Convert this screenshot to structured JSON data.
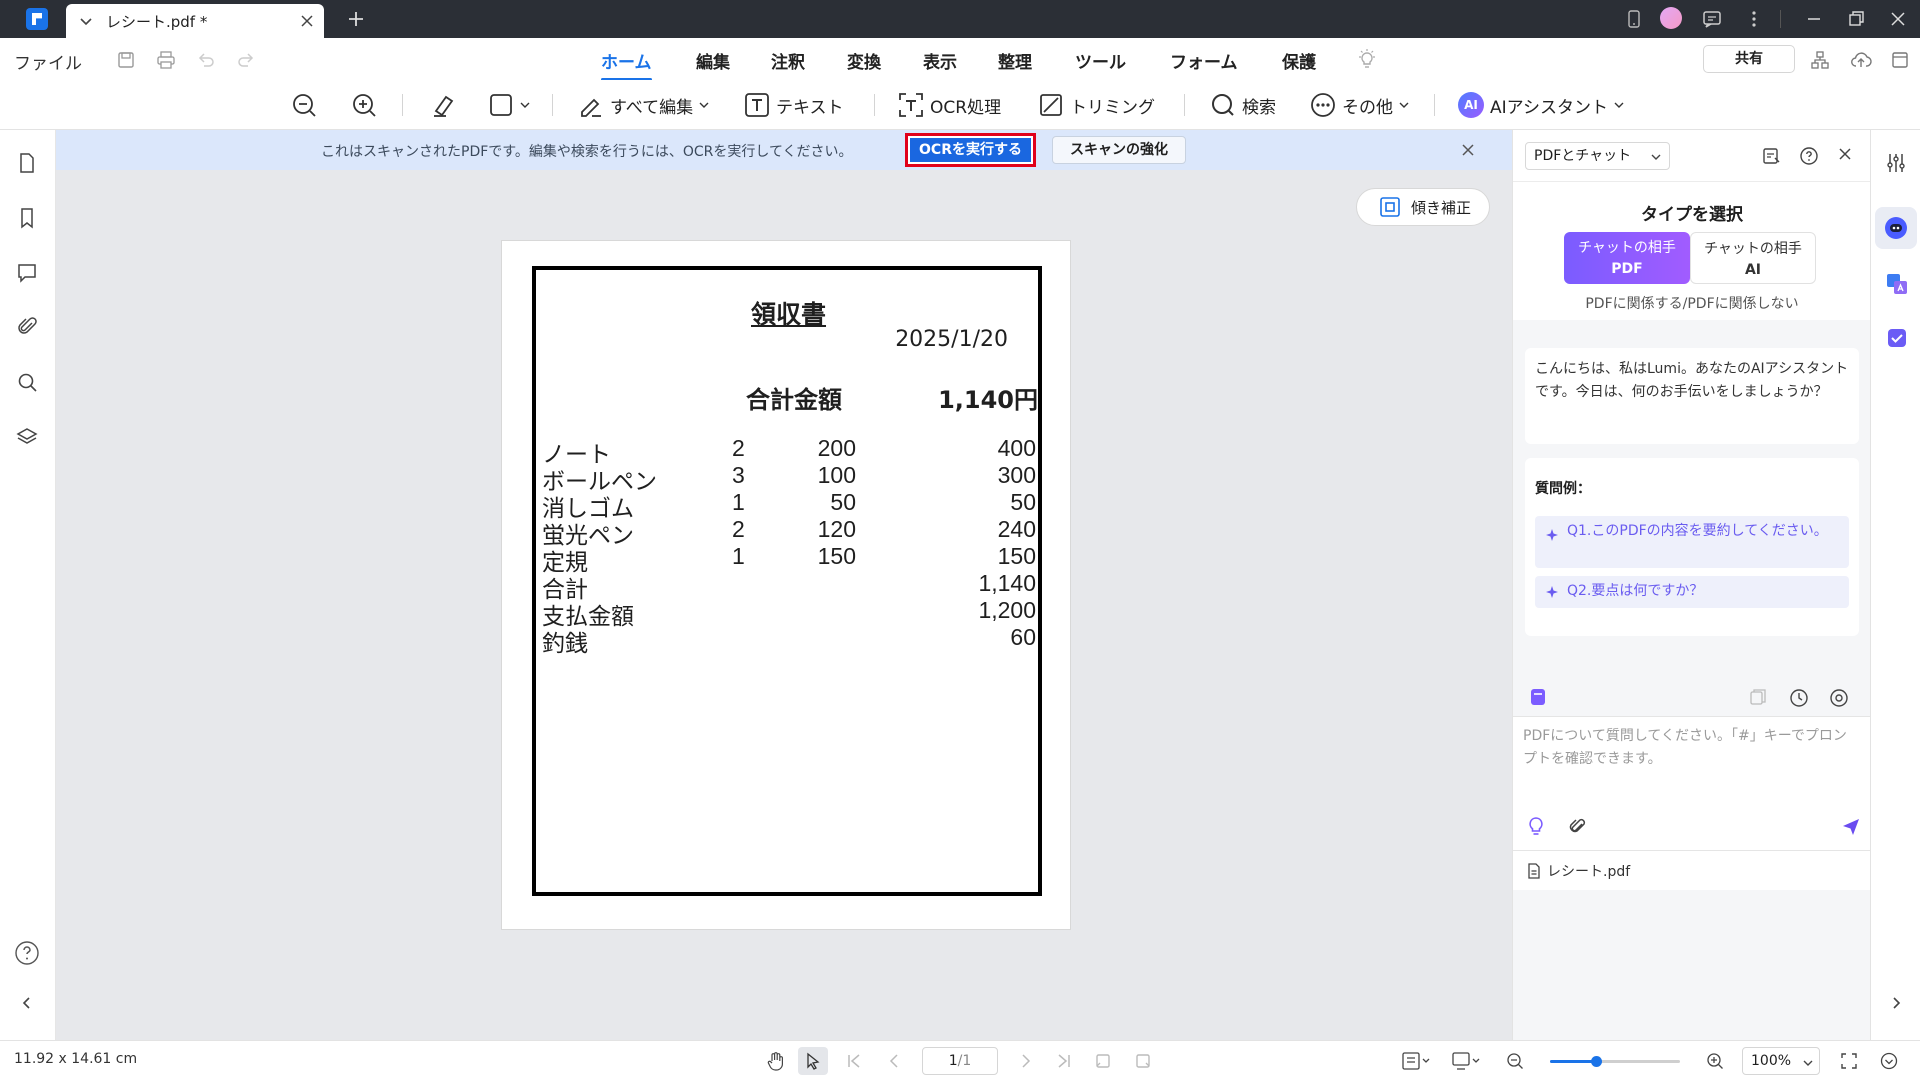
{
  "titlebar": {
    "tab_title": "レシート.pdf *"
  },
  "menu": {
    "file": "ファイル",
    "tabs": [
      {
        "label": "ホーム",
        "active": true
      },
      {
        "label": "編集",
        "active": false
      },
      {
        "label": "注釈",
        "active": false
      },
      {
        "label": "変換",
        "active": false
      },
      {
        "label": "表示",
        "active": false
      },
      {
        "label": "整理",
        "active": false
      },
      {
        "label": "ツール",
        "active": false
      },
      {
        "label": "フォーム",
        "active": false
      },
      {
        "label": "保護",
        "active": false
      }
    ],
    "share": "共有"
  },
  "toolbar": {
    "edit_all": "すべて編集",
    "text": "テキスト",
    "ocr": "OCR処理",
    "crop": "トリミング",
    "search": "検索",
    "more": "その他",
    "ai_badge": "AI",
    "ai_assistant": "AIアシスタント"
  },
  "ocr_banner": {
    "message": "これはスキャンされたPDFです。編集や検索を行うには、OCRを実行してください。",
    "run_ocr": "OCRを実行する",
    "enhance_scan": "スキャンの強化"
  },
  "canvas": {
    "deskew": "傾き補正"
  },
  "receipt": {
    "title": "領収書",
    "date": "2025/1/20",
    "total_label": "合計金額",
    "total_value": "1,140円",
    "rows": [
      {
        "name": "ノート",
        "qty": "2",
        "price": "200",
        "amount": "400"
      },
      {
        "name": "ボールペン",
        "qty": "3",
        "price": "100",
        "amount": "300"
      },
      {
        "name": "消しゴム",
        "qty": "1",
        "price": "50",
        "amount": "50"
      },
      {
        "name": "蛍光ペン",
        "qty": "2",
        "price": "120",
        "amount": "240"
      },
      {
        "name": "定規",
        "qty": "1",
        "price": "150",
        "amount": "150"
      },
      {
        "name": "合計",
        "qty": "",
        "price": "",
        "amount": "1,140"
      },
      {
        "name": "支払金額",
        "qty": "",
        "price": "",
        "amount": "1,200"
      },
      {
        "name": "釣銭",
        "qty": "",
        "price": "",
        "amount": "60"
      }
    ]
  },
  "ai_panel": {
    "mode_select": "PDFとチャット",
    "type_title": "タイプを選択",
    "option_pdf_line1": "チャットの相手",
    "option_pdf_line2": "PDF",
    "option_ai_line1": "チャットの相手",
    "option_ai_line2": "AI",
    "type_note": "PDFに関係する/PDFに関係しない",
    "greeting": "こんにちは、私はLumi。あなたのAIアシスタントです。今日は、何のお手伝いをしましょうか？",
    "examples_title": "質問例：",
    "examples": [
      "Q1.このPDFの内容を要約してください。",
      "Q2.要点は何ですか？"
    ],
    "input_placeholder": "PDFについて質問してください。「#」キーでプロンプトを確認できます。",
    "file_name": "レシート.pdf"
  },
  "status": {
    "dimensions": "11.92 x 14.61 cm",
    "page_current": "1",
    "page_total": "/1",
    "zoom_level": "100%",
    "zoom_fraction": 0.35
  },
  "colors": {
    "accent": "#1a73e8",
    "ocr_button_bg": "#1a67e0",
    "highlight_border": "#e0001b",
    "banner_bg": "#dbe7fb",
    "ai_purple": "#7b5cff"
  }
}
